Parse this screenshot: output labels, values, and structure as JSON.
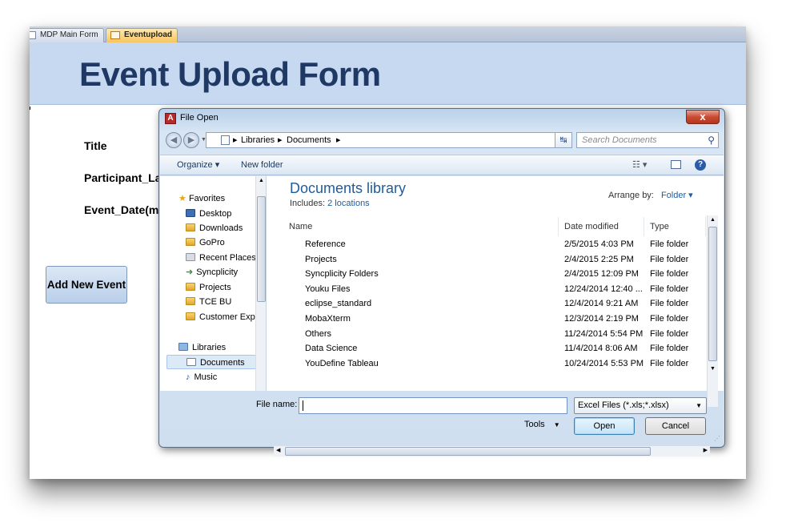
{
  "tabs": [
    {
      "label": "MDP Main Form"
    },
    {
      "label": "Eventupload"
    }
  ],
  "form": {
    "title": "Event Upload Form",
    "fields": [
      "Title",
      "Participant_La",
      "Event_Date(m"
    ],
    "add_button": "Add New Event"
  },
  "dialog": {
    "title": "File Open",
    "app_icon": "A",
    "close_icon": "x",
    "breadcrumb": [
      "Libraries",
      "Documents"
    ],
    "search_placeholder": "Search Documents",
    "toolbar": {
      "organize": "Organize ▾",
      "new_folder": "New folder"
    },
    "nav": {
      "favorites_label": "Favorites",
      "favorites": [
        "Desktop",
        "Downloads",
        "GoPro",
        "Recent Places",
        "Syncplicity",
        "Projects",
        "TCE BU",
        "Customer Experie"
      ],
      "libraries_label": "Libraries",
      "libraries": [
        "Documents",
        "Music"
      ]
    },
    "library": {
      "title": "Documents library",
      "includes_prefix": "Includes:",
      "includes_link": "2 locations",
      "arrange_by": "Arrange by:",
      "arrange_value": "Folder ▾"
    },
    "columns": {
      "name": "Name",
      "date": "Date modified",
      "type": "Type"
    },
    "files": [
      {
        "name": "Reference",
        "date": "2/5/2015 4:03 PM",
        "type": "File folder"
      },
      {
        "name": "Projects",
        "date": "2/4/2015 2:25 PM",
        "type": "File folder"
      },
      {
        "name": "Syncplicity Folders",
        "date": "2/4/2015 12:09 PM",
        "type": "File folder"
      },
      {
        "name": "Youku Files",
        "date": "12/24/2014 12:40 ...",
        "type": "File folder"
      },
      {
        "name": "eclipse_standard",
        "date": "12/4/2014 9:21 AM",
        "type": "File folder"
      },
      {
        "name": "MobaXterm",
        "date": "12/3/2014 2:19 PM",
        "type": "File folder"
      },
      {
        "name": "Others",
        "date": "11/24/2014 5:54 PM",
        "type": "File folder"
      },
      {
        "name": "Data Science",
        "date": "11/4/2014 8:06 AM",
        "type": "File folder"
      },
      {
        "name": "YouDefine Tableau",
        "date": "10/24/2014 5:53 PM",
        "type": "File folder"
      }
    ],
    "file_name_label": "File name:",
    "file_name_value": "",
    "filter": "Excel Files (*.xls;*.xlsx)",
    "tools": "Tools",
    "open": "Open",
    "cancel": "Cancel"
  },
  "colors": {
    "header_bg": "#c6d9f1",
    "title_color": "#1f3864",
    "folder": "#e8b84a",
    "link": "#1e5c9c"
  }
}
